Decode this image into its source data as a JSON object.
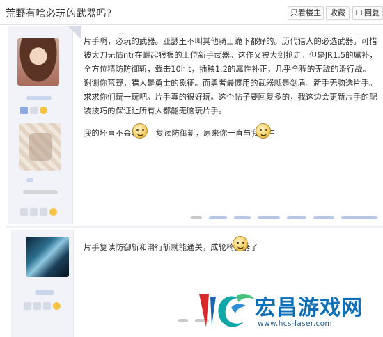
{
  "header": {
    "title": "荒野有啥必玩的武器吗?",
    "only_op_label": "只看楼主",
    "favorite_label": "收藏",
    "reply_label": "回复"
  },
  "posts": [
    {
      "paragraph_1": "片手啊，必玩的武器。亚瑟王不叫其他骑士跪下都好的。历代猎人的必选武器。可惜被太刀无情ntr在崛起狠狠的上位新手武器。这作又被大剑抢走。但是JR1.5的属补，全方位精防防御斩，载击10hit，插秧1.2的属性补正，几乎全程的无敌的滑行战。谢谢你荒野，猎人是勇士的象征。而勇者最惯用的武器就是剑盾。新手无脑选片手。求求你们玩一玩吧。片手真的很好玩。这个帖子要回复多的，我这边会更新片手的配装技巧的保证让所有人都能无脑玩片手。",
      "line2_a": "我的坏直不会输",
      "line2_b": "复读防御斩，原来你一直与我同在"
    },
    {
      "paragraph_1": "片手复读防御斩和滑行斩就能通关，成轮椅武器了"
    }
  ],
  "watermark": {
    "title": "宏昌游戏网",
    "url": "www.hcs-laser.com"
  },
  "colors": {
    "sidebar_bg": "#f1f3f9",
    "watermark_blue": "#0c6fb8",
    "blurred_link": "#b8c6e8"
  }
}
